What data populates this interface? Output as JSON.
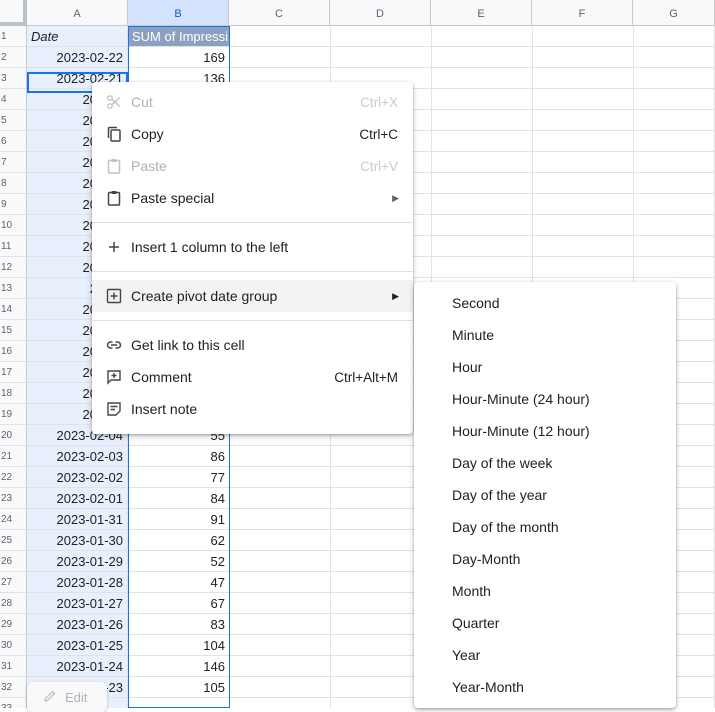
{
  "columns": [
    "A",
    "B",
    "C",
    "D",
    "E",
    "F",
    "G"
  ],
  "rows": [
    [
      "1",
      "Date",
      "SUM of Impressi"
    ],
    [
      "2",
      "2023-02-22",
      "169"
    ],
    [
      "3",
      "2023-02-21",
      "136"
    ],
    [
      "4",
      "2023-0",
      ""
    ],
    [
      "5",
      "2023-0",
      ""
    ],
    [
      "6",
      "2023-0",
      ""
    ],
    [
      "7",
      "2023-0",
      ""
    ],
    [
      "8",
      "2023-0",
      ""
    ],
    [
      "9",
      "2023-0",
      ""
    ],
    [
      "10",
      "2023-0",
      ""
    ],
    [
      "11",
      "2023-0",
      ""
    ],
    [
      "12",
      "2023-0",
      ""
    ],
    [
      "13",
      "2023-",
      ""
    ],
    [
      "14",
      "2023-0",
      ""
    ],
    [
      "15",
      "2023-0",
      ""
    ],
    [
      "16",
      "2023-0",
      ""
    ],
    [
      "17",
      "2023-0",
      ""
    ],
    [
      "18",
      "2023-0",
      ""
    ],
    [
      "19",
      "2023-0",
      ""
    ],
    [
      "20",
      "2023-02-04",
      "55"
    ],
    [
      "21",
      "2023-02-03",
      "86"
    ],
    [
      "22",
      "2023-02-02",
      "77"
    ],
    [
      "23",
      "2023-02-01",
      "84"
    ],
    [
      "24",
      "2023-01-31",
      "91"
    ],
    [
      "25",
      "2023-01-30",
      "62"
    ],
    [
      "26",
      "2023-01-29",
      "52"
    ],
    [
      "27",
      "2023-01-28",
      "47"
    ],
    [
      "28",
      "2023-01-27",
      "67"
    ],
    [
      "29",
      "2023-01-26",
      "83"
    ],
    [
      "30",
      "2023-01-25",
      "104"
    ],
    [
      "31",
      "2023-01-24",
      "146"
    ],
    [
      "32",
      "2023-01-23",
      "105"
    ],
    [
      "33",
      "",
      ""
    ]
  ],
  "context_menu": {
    "cut": {
      "label": "Cut",
      "shortcut": "Ctrl+X"
    },
    "copy": {
      "label": "Copy",
      "shortcut": "Ctrl+C"
    },
    "paste": {
      "label": "Paste",
      "shortcut": "Ctrl+V"
    },
    "paste_special": {
      "label": "Paste special"
    },
    "insert_column": {
      "label": "Insert 1 column to the left"
    },
    "pivot_date_group": {
      "label": "Create pivot date group"
    },
    "get_link": {
      "label": "Get link to this cell"
    },
    "comment": {
      "label": "Comment",
      "shortcut": "Ctrl+Alt+M"
    },
    "insert_note": {
      "label": "Insert note"
    }
  },
  "submenu": [
    "Second",
    "Minute",
    "Hour",
    "Hour-Minute (24 hour)",
    "Hour-Minute (12 hour)",
    "Day of the week",
    "Day of the year",
    "Day of the month",
    "Day-Month",
    "Month",
    "Quarter",
    "Year",
    "Year-Month"
  ],
  "edit_chip": {
    "label": "Edit"
  },
  "colors": {
    "accent": "#1a73e8",
    "pivot_header": "#8da0bf",
    "selection": "#e8f0fe"
  }
}
